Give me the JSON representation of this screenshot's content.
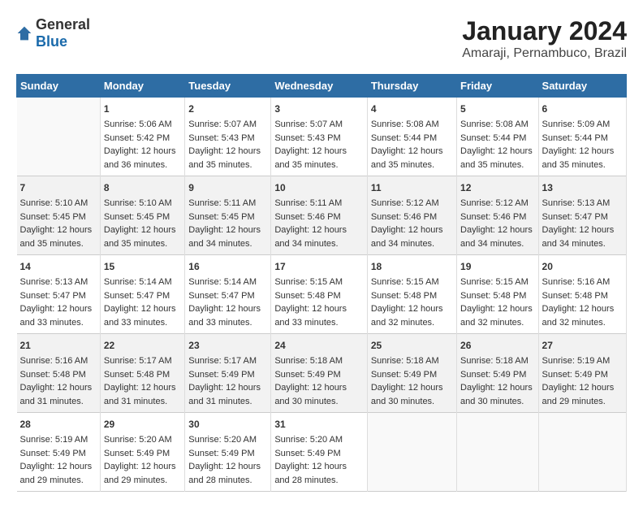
{
  "logo": {
    "text_general": "General",
    "text_blue": "Blue"
  },
  "title": "January 2024",
  "subtitle": "Amaraji, Pernambuco, Brazil",
  "days_of_week": [
    "Sunday",
    "Monday",
    "Tuesday",
    "Wednesday",
    "Thursday",
    "Friday",
    "Saturday"
  ],
  "weeks": [
    [
      {
        "day": "",
        "sunrise": "",
        "sunset": "",
        "daylight": ""
      },
      {
        "day": "1",
        "sunrise": "Sunrise: 5:06 AM",
        "sunset": "Sunset: 5:42 PM",
        "daylight": "Daylight: 12 hours and 36 minutes."
      },
      {
        "day": "2",
        "sunrise": "Sunrise: 5:07 AM",
        "sunset": "Sunset: 5:43 PM",
        "daylight": "Daylight: 12 hours and 35 minutes."
      },
      {
        "day": "3",
        "sunrise": "Sunrise: 5:07 AM",
        "sunset": "Sunset: 5:43 PM",
        "daylight": "Daylight: 12 hours and 35 minutes."
      },
      {
        "day": "4",
        "sunrise": "Sunrise: 5:08 AM",
        "sunset": "Sunset: 5:44 PM",
        "daylight": "Daylight: 12 hours and 35 minutes."
      },
      {
        "day": "5",
        "sunrise": "Sunrise: 5:08 AM",
        "sunset": "Sunset: 5:44 PM",
        "daylight": "Daylight: 12 hours and 35 minutes."
      },
      {
        "day": "6",
        "sunrise": "Sunrise: 5:09 AM",
        "sunset": "Sunset: 5:44 PM",
        "daylight": "Daylight: 12 hours and 35 minutes."
      }
    ],
    [
      {
        "day": "7",
        "sunrise": "Sunrise: 5:10 AM",
        "sunset": "Sunset: 5:45 PM",
        "daylight": "Daylight: 12 hours and 35 minutes."
      },
      {
        "day": "8",
        "sunrise": "Sunrise: 5:10 AM",
        "sunset": "Sunset: 5:45 PM",
        "daylight": "Daylight: 12 hours and 35 minutes."
      },
      {
        "day": "9",
        "sunrise": "Sunrise: 5:11 AM",
        "sunset": "Sunset: 5:45 PM",
        "daylight": "Daylight: 12 hours and 34 minutes."
      },
      {
        "day": "10",
        "sunrise": "Sunrise: 5:11 AM",
        "sunset": "Sunset: 5:46 PM",
        "daylight": "Daylight: 12 hours and 34 minutes."
      },
      {
        "day": "11",
        "sunrise": "Sunrise: 5:12 AM",
        "sunset": "Sunset: 5:46 PM",
        "daylight": "Daylight: 12 hours and 34 minutes."
      },
      {
        "day": "12",
        "sunrise": "Sunrise: 5:12 AM",
        "sunset": "Sunset: 5:46 PM",
        "daylight": "Daylight: 12 hours and 34 minutes."
      },
      {
        "day": "13",
        "sunrise": "Sunrise: 5:13 AM",
        "sunset": "Sunset: 5:47 PM",
        "daylight": "Daylight: 12 hours and 34 minutes."
      }
    ],
    [
      {
        "day": "14",
        "sunrise": "Sunrise: 5:13 AM",
        "sunset": "Sunset: 5:47 PM",
        "daylight": "Daylight: 12 hours and 33 minutes."
      },
      {
        "day": "15",
        "sunrise": "Sunrise: 5:14 AM",
        "sunset": "Sunset: 5:47 PM",
        "daylight": "Daylight: 12 hours and 33 minutes."
      },
      {
        "day": "16",
        "sunrise": "Sunrise: 5:14 AM",
        "sunset": "Sunset: 5:47 PM",
        "daylight": "Daylight: 12 hours and 33 minutes."
      },
      {
        "day": "17",
        "sunrise": "Sunrise: 5:15 AM",
        "sunset": "Sunset: 5:48 PM",
        "daylight": "Daylight: 12 hours and 33 minutes."
      },
      {
        "day": "18",
        "sunrise": "Sunrise: 5:15 AM",
        "sunset": "Sunset: 5:48 PM",
        "daylight": "Daylight: 12 hours and 32 minutes."
      },
      {
        "day": "19",
        "sunrise": "Sunrise: 5:15 AM",
        "sunset": "Sunset: 5:48 PM",
        "daylight": "Daylight: 12 hours and 32 minutes."
      },
      {
        "day": "20",
        "sunrise": "Sunrise: 5:16 AM",
        "sunset": "Sunset: 5:48 PM",
        "daylight": "Daylight: 12 hours and 32 minutes."
      }
    ],
    [
      {
        "day": "21",
        "sunrise": "Sunrise: 5:16 AM",
        "sunset": "Sunset: 5:48 PM",
        "daylight": "Daylight: 12 hours and 31 minutes."
      },
      {
        "day": "22",
        "sunrise": "Sunrise: 5:17 AM",
        "sunset": "Sunset: 5:48 PM",
        "daylight": "Daylight: 12 hours and 31 minutes."
      },
      {
        "day": "23",
        "sunrise": "Sunrise: 5:17 AM",
        "sunset": "Sunset: 5:49 PM",
        "daylight": "Daylight: 12 hours and 31 minutes."
      },
      {
        "day": "24",
        "sunrise": "Sunrise: 5:18 AM",
        "sunset": "Sunset: 5:49 PM",
        "daylight": "Daylight: 12 hours and 30 minutes."
      },
      {
        "day": "25",
        "sunrise": "Sunrise: 5:18 AM",
        "sunset": "Sunset: 5:49 PM",
        "daylight": "Daylight: 12 hours and 30 minutes."
      },
      {
        "day": "26",
        "sunrise": "Sunrise: 5:18 AM",
        "sunset": "Sunset: 5:49 PM",
        "daylight": "Daylight: 12 hours and 30 minutes."
      },
      {
        "day": "27",
        "sunrise": "Sunrise: 5:19 AM",
        "sunset": "Sunset: 5:49 PM",
        "daylight": "Daylight: 12 hours and 29 minutes."
      }
    ],
    [
      {
        "day": "28",
        "sunrise": "Sunrise: 5:19 AM",
        "sunset": "Sunset: 5:49 PM",
        "daylight": "Daylight: 12 hours and 29 minutes."
      },
      {
        "day": "29",
        "sunrise": "Sunrise: 5:20 AM",
        "sunset": "Sunset: 5:49 PM",
        "daylight": "Daylight: 12 hours and 29 minutes."
      },
      {
        "day": "30",
        "sunrise": "Sunrise: 5:20 AM",
        "sunset": "Sunset: 5:49 PM",
        "daylight": "Daylight: 12 hours and 28 minutes."
      },
      {
        "day": "31",
        "sunrise": "Sunrise: 5:20 AM",
        "sunset": "Sunset: 5:49 PM",
        "daylight": "Daylight: 12 hours and 28 minutes."
      },
      {
        "day": "",
        "sunrise": "",
        "sunset": "",
        "daylight": ""
      },
      {
        "day": "",
        "sunrise": "",
        "sunset": "",
        "daylight": ""
      },
      {
        "day": "",
        "sunrise": "",
        "sunset": "",
        "daylight": ""
      }
    ]
  ]
}
